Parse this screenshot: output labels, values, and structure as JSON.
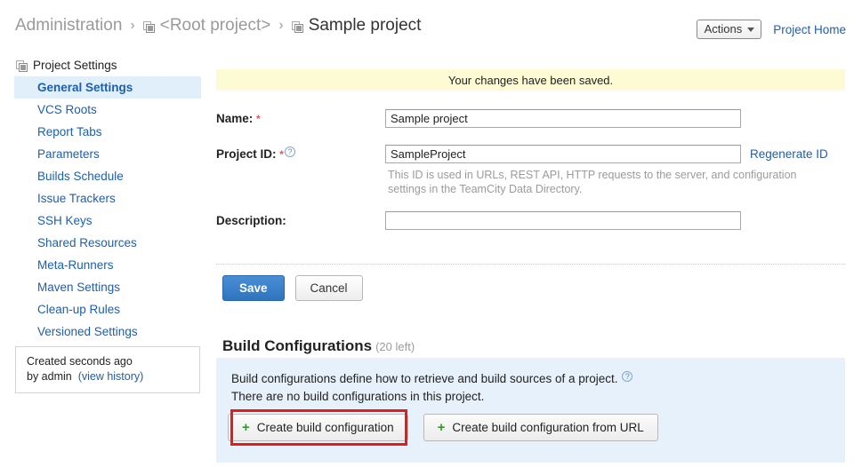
{
  "header": {
    "breadcrumb": [
      {
        "label": "Administration",
        "icon": null,
        "current": false
      },
      {
        "label": "<Root project>",
        "icon": "project-icon",
        "current": false
      },
      {
        "label": "Sample project",
        "icon": "project-icon",
        "current": true
      }
    ],
    "separator": "›",
    "actions_label": "Actions",
    "project_home_label": "Project Home"
  },
  "sidebar": {
    "title": "Project Settings",
    "title_icon": "project-icon",
    "items": [
      {
        "label": "General Settings",
        "active": true
      },
      {
        "label": "VCS Roots",
        "active": false
      },
      {
        "label": "Report Tabs",
        "active": false
      },
      {
        "label": "Parameters",
        "active": false
      },
      {
        "label": "Builds Schedule",
        "active": false
      },
      {
        "label": "Issue Trackers",
        "active": false
      },
      {
        "label": "SSH Keys",
        "active": false
      },
      {
        "label": "Shared Resources",
        "active": false
      },
      {
        "label": "Meta-Runners",
        "active": false
      },
      {
        "label": "Maven Settings",
        "active": false
      },
      {
        "label": "Clean-up Rules",
        "active": false
      },
      {
        "label": "Versioned Settings",
        "active": false
      }
    ],
    "created_box": {
      "line1": "Created seconds ago",
      "line2_prefix": "by admin",
      "history_link": "(view history)"
    }
  },
  "main": {
    "saved_banner": "Your changes have been saved.",
    "fields": {
      "name": {
        "label": "Name:",
        "required_marker": "*",
        "value": "Sample project",
        "placeholder": ""
      },
      "project_id": {
        "label": "Project ID:",
        "required_marker": "*",
        "help_icon": "question-mark-icon",
        "value": "SampleProject",
        "placeholder": "",
        "regenerate_link": "Regenerate ID",
        "hint": "This ID is used in URLs, REST API, HTTP requests to the server, and configuration settings in the TeamCity Data Directory."
      },
      "description": {
        "label": "Description:",
        "value": "",
        "placeholder": ""
      }
    },
    "save_label": "Save",
    "cancel_label": "Cancel",
    "build_configs": {
      "heading": "Build Configurations",
      "count_note": "(20 left)",
      "description": "Build configurations define how to retrieve and build sources of a project.",
      "help_icon": "question-mark-icon",
      "empty_message": "There are no build configurations in this project.",
      "create_button": "Create build configuration",
      "create_from_url_button": "Create build configuration from URL",
      "plus_icon": "plus-icon"
    }
  },
  "colors": {
    "link": "#1c5fb0",
    "banner_bg": "#fdfbd3",
    "panel_bg": "#e7f1fb",
    "active_nav_bg": "#e1effa",
    "highlight_border": "#e81b1b",
    "plus_green": "#2c9d2c",
    "save_blue": "#2f74c0",
    "required_red": "#e8564f"
  }
}
